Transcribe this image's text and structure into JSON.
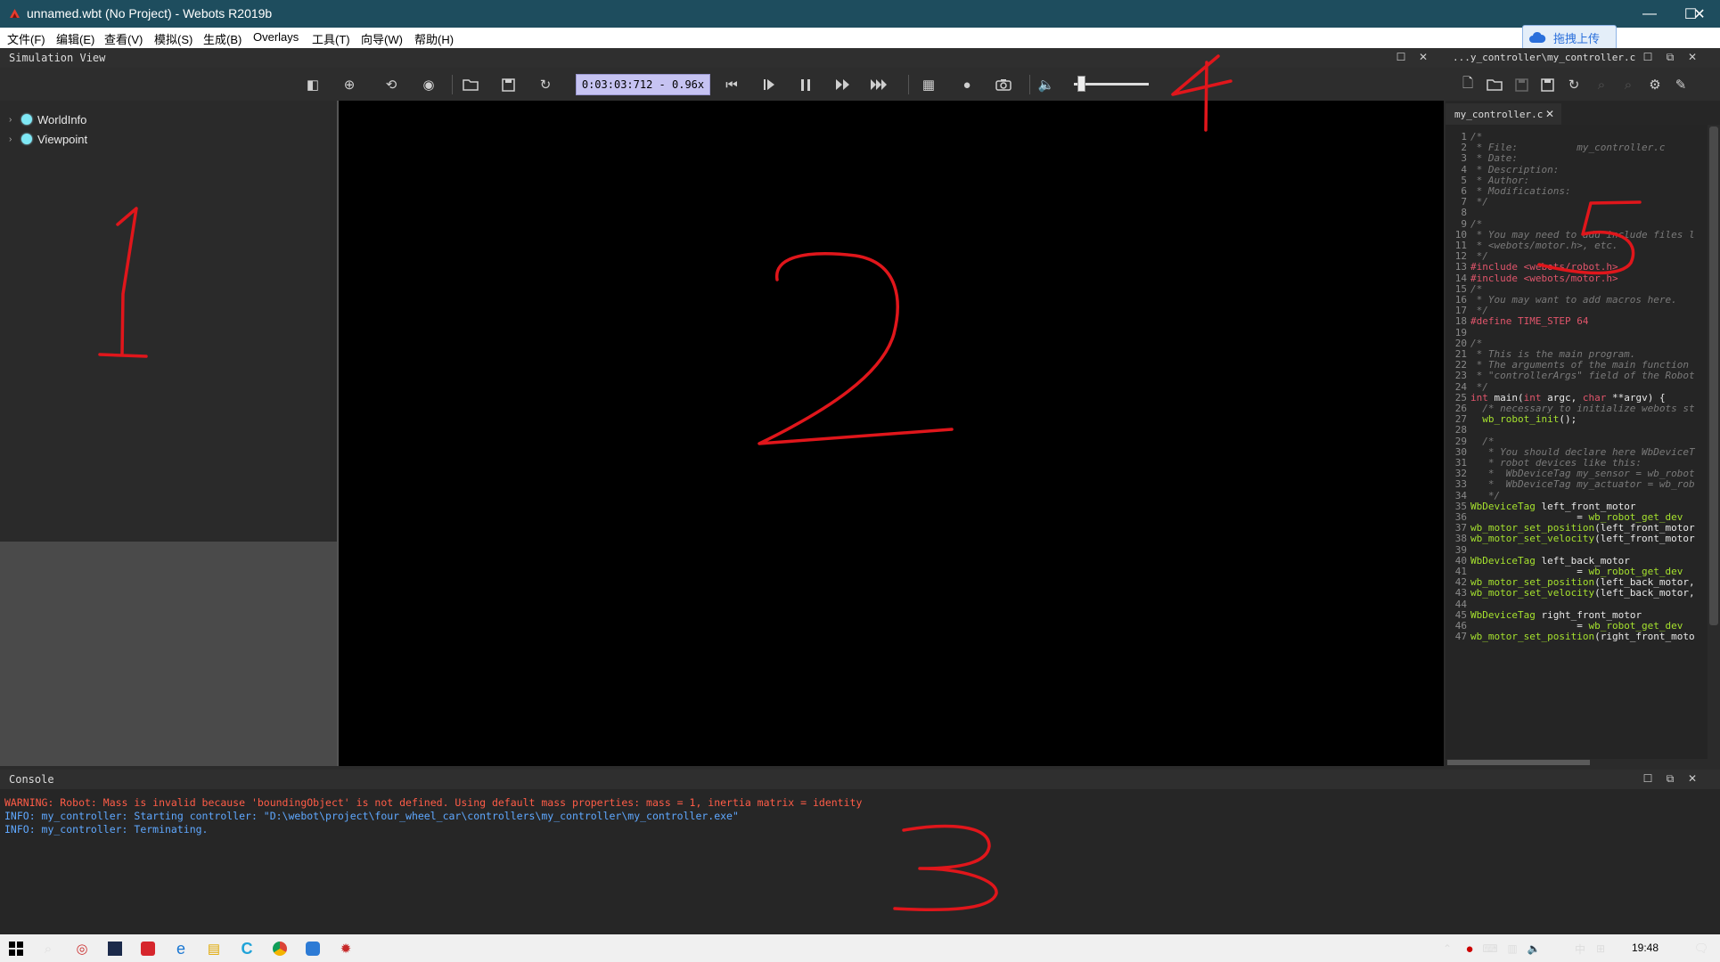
{
  "window": {
    "title": "unnamed.wbt (No Project) - Webots R2019b",
    "minimize_glyph": "—",
    "maximize_glyph": "☐",
    "close_glyph": "✕"
  },
  "upload_button": {
    "label": "拖拽上传",
    "icon": "cloud-icon"
  },
  "menu": [
    "文件(F)",
    "编辑(E)",
    "查看(V)",
    "模拟(S)",
    "生成(B)",
    "Overlays",
    "工具(T)",
    "向导(W)",
    "帮助(H)"
  ],
  "simulation_view": {
    "title": "Simulation View"
  },
  "editor_panel": {
    "title": "...y_controller\\my_controller.c"
  },
  "toolbar": {
    "time": "0:03:03:712  -  0.96x",
    "volume_level": 0.05
  },
  "scene_tree": {
    "items": [
      {
        "label": "WorldInfo"
      },
      {
        "label": "Viewpoint"
      }
    ]
  },
  "editor": {
    "tab_label": "my_controller.c",
    "lines": [
      {
        "n": "1",
        "parts": [
          [
            "c-comment",
            "/*"
          ]
        ]
      },
      {
        "n": "2",
        "parts": [
          [
            "c-comment",
            " * File:          my_controller.c"
          ]
        ]
      },
      {
        "n": "3",
        "parts": [
          [
            "c-comment",
            " * Date:"
          ]
        ]
      },
      {
        "n": "4",
        "parts": [
          [
            "c-comment",
            " * Description:"
          ]
        ]
      },
      {
        "n": "5",
        "parts": [
          [
            "c-comment",
            " * Author:"
          ]
        ]
      },
      {
        "n": "6",
        "parts": [
          [
            "c-comment",
            " * Modifications:"
          ]
        ]
      },
      {
        "n": "7",
        "parts": [
          [
            "c-comment",
            " */"
          ]
        ]
      },
      {
        "n": "8",
        "parts": []
      },
      {
        "n": "9",
        "parts": [
          [
            "c-comment",
            "/*"
          ]
        ]
      },
      {
        "n": "10",
        "parts": [
          [
            "c-comment",
            " * You may need to add include files l"
          ]
        ]
      },
      {
        "n": "11",
        "parts": [
          [
            "c-comment",
            " * <webots/motor.h>, etc."
          ]
        ]
      },
      {
        "n": "12",
        "parts": [
          [
            "c-comment",
            " */"
          ]
        ]
      },
      {
        "n": "13",
        "parts": [
          [
            "c-pre",
            "#include <webots/robot.h>"
          ]
        ]
      },
      {
        "n": "14",
        "parts": [
          [
            "c-pre",
            "#include <webots/motor.h>"
          ]
        ]
      },
      {
        "n": "15",
        "parts": [
          [
            "c-comment",
            "/*"
          ]
        ]
      },
      {
        "n": "16",
        "parts": [
          [
            "c-comment",
            " * You may want to add macros here."
          ]
        ]
      },
      {
        "n": "17",
        "parts": [
          [
            "c-comment",
            " */"
          ]
        ]
      },
      {
        "n": "18",
        "parts": [
          [
            "c-pre",
            "#define TIME_STEP 64"
          ]
        ]
      },
      {
        "n": "19",
        "parts": []
      },
      {
        "n": "20",
        "parts": [
          [
            "c-comment",
            "/*"
          ]
        ]
      },
      {
        "n": "21",
        "parts": [
          [
            "c-comment",
            " * This is the main program."
          ]
        ]
      },
      {
        "n": "22",
        "parts": [
          [
            "c-comment",
            " * The arguments of the main function"
          ]
        ]
      },
      {
        "n": "23",
        "parts": [
          [
            "c-comment",
            " * \"controllerArgs\" field of the Robot"
          ]
        ]
      },
      {
        "n": "24",
        "parts": [
          [
            "c-comment",
            " */"
          ]
        ]
      },
      {
        "n": "25",
        "parts": [
          [
            "c-kw",
            "int"
          ],
          [
            "c-plain",
            " main("
          ],
          [
            "c-kw",
            "int"
          ],
          [
            "c-plain",
            " argc, "
          ],
          [
            "c-kw",
            "char"
          ],
          [
            "c-plain",
            " **argv) {"
          ]
        ]
      },
      {
        "n": "26",
        "parts": [
          [
            "c-comment",
            "  /* necessary to initialize webots st"
          ]
        ]
      },
      {
        "n": "27",
        "parts": [
          [
            "c-plain",
            "  "
          ],
          [
            "c-fn",
            "wb_robot_init"
          ],
          [
            "c-plain",
            "();"
          ]
        ]
      },
      {
        "n": "28",
        "parts": []
      },
      {
        "n": "29",
        "parts": [
          [
            "c-comment",
            "  /*"
          ]
        ]
      },
      {
        "n": "30",
        "parts": [
          [
            "c-comment",
            "   * You should declare here WbDeviceT"
          ]
        ]
      },
      {
        "n": "31",
        "parts": [
          [
            "c-comment",
            "   * robot devices like this:"
          ]
        ]
      },
      {
        "n": "32",
        "parts": [
          [
            "c-comment",
            "   *  WbDeviceTag my_sensor = wb_robot"
          ]
        ]
      },
      {
        "n": "33",
        "parts": [
          [
            "c-comment",
            "   *  WbDeviceTag my_actuator = wb_rob"
          ]
        ]
      },
      {
        "n": "34",
        "parts": [
          [
            "c-comment",
            "   */"
          ]
        ]
      },
      {
        "n": "35",
        "parts": [
          [
            "c-fn",
            "WbDeviceTag"
          ],
          [
            "c-plain",
            " left_front_motor"
          ]
        ]
      },
      {
        "n": "36",
        "parts": [
          [
            "c-plain",
            "                  = "
          ],
          [
            "c-fn",
            "wb_robot_get_dev"
          ]
        ]
      },
      {
        "n": "37",
        "parts": [
          [
            "c-fn",
            "wb_motor_set_position"
          ],
          [
            "c-plain",
            "(left_front_motor"
          ]
        ]
      },
      {
        "n": "38",
        "parts": [
          [
            "c-fn",
            "wb_motor_set_velocity"
          ],
          [
            "c-plain",
            "(left_front_motor"
          ]
        ]
      },
      {
        "n": "39",
        "parts": []
      },
      {
        "n": "40",
        "parts": [
          [
            "c-fn",
            "WbDeviceTag"
          ],
          [
            "c-plain",
            " left_back_motor"
          ]
        ]
      },
      {
        "n": "41",
        "parts": [
          [
            "c-plain",
            "                  = "
          ],
          [
            "c-fn",
            "wb_robot_get_dev"
          ]
        ]
      },
      {
        "n": "42",
        "parts": [
          [
            "c-fn",
            "wb_motor_set_position"
          ],
          [
            "c-plain",
            "(left_back_motor,"
          ]
        ]
      },
      {
        "n": "43",
        "parts": [
          [
            "c-fn",
            "wb_motor_set_velocity"
          ],
          [
            "c-plain",
            "(left_back_motor,"
          ]
        ]
      },
      {
        "n": "44",
        "parts": []
      },
      {
        "n": "45",
        "parts": [
          [
            "c-fn",
            "WbDeviceTag"
          ],
          [
            "c-plain",
            " right_front_motor"
          ]
        ]
      },
      {
        "n": "46",
        "parts": [
          [
            "c-plain",
            "                  = "
          ],
          [
            "c-fn",
            "wb_robot_get_dev"
          ]
        ]
      },
      {
        "n": "47",
        "parts": [
          [
            "c-fn",
            "wb_motor_set_position"
          ],
          [
            "c-plain",
            "(right_front_moto"
          ]
        ]
      }
    ]
  },
  "console": {
    "title": "Console",
    "lines": [
      {
        "text": "WARNING: Robot: Mass is invalid because 'boundingObject' is not defined. Using default mass properties: mass = 1, inertia matrix = identity",
        "color": "#ff5c47"
      },
      {
        "text": "INFO: my_controller: Starting controller: \"D:\\webot\\project\\four_wheel_car\\controllers\\my_controller\\my_controller.exe\"",
        "color": "#5fa8ff"
      },
      {
        "text": "INFO: my_controller: Terminating.",
        "color": "#5fa8ff"
      }
    ]
  },
  "taskbar": {
    "clock": "19:48",
    "ime_label": "中"
  },
  "annotations": {
    "color": "#e0161b",
    "labels": [
      "1",
      "2",
      "3",
      "4",
      "5"
    ]
  },
  "colors": {
    "titlebar": "#1e4d5e",
    "time_display": "#c6c3f2",
    "viewport": "#000000"
  }
}
